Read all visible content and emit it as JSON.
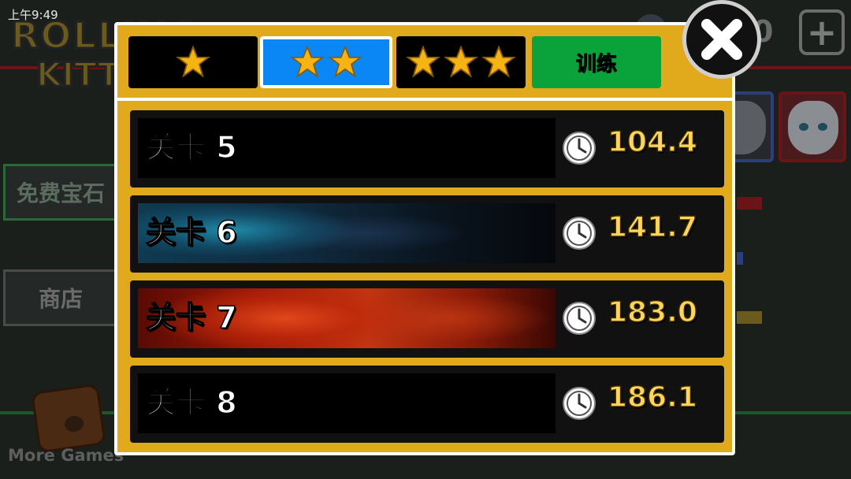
{
  "status_bar": {
    "time": "上午9:49"
  },
  "background": {
    "logo_line1": "ROLLING",
    "logo_line2": "KITTY",
    "gem_count": "0",
    "free_gems_label": "免费宝石",
    "shop_label": "商店",
    "more_games_label": "More Games"
  },
  "dialog": {
    "tabs": [
      {
        "id": "one-star",
        "stars": 1,
        "selected": false
      },
      {
        "id": "two-star",
        "stars": 2,
        "selected": true
      },
      {
        "id": "three-star",
        "stars": 3,
        "selected": false
      },
      {
        "id": "training",
        "label": "训练",
        "selected": false
      }
    ],
    "levels": [
      {
        "name": "关卡 5",
        "time": "104.4",
        "theme": "black"
      },
      {
        "name": "关卡 6",
        "time": "141.7",
        "theme": "blue-nebula"
      },
      {
        "name": "关卡 7",
        "time": "183.0",
        "theme": "red-nebula"
      },
      {
        "name": "关卡 8",
        "time": "186.1",
        "theme": "black"
      }
    ]
  },
  "colors": {
    "dialog_bg": "#e1aa1c",
    "tab_selected": "#0a86f5",
    "tab_training": "#0aa23a",
    "time_text": "#ffd659",
    "star": "#f6b414"
  },
  "icons": [
    "star-icon",
    "clock-icon",
    "close-icon",
    "plus-icon",
    "gem-icon"
  ]
}
